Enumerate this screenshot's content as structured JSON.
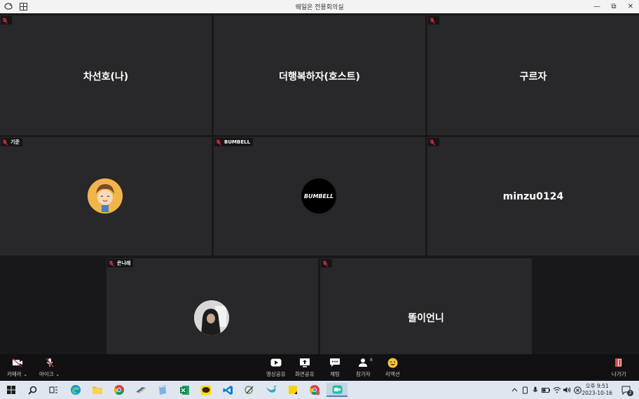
{
  "window": {
    "title": "웨일온 전용회의실",
    "minimize": "—",
    "restore": "⧉",
    "close": "✕"
  },
  "participants": [
    {
      "id": "p1",
      "center_name": "차선호(나)",
      "tag_name": ""
    },
    {
      "id": "p2",
      "center_name": "더행복하자(호스트)",
      "tag_name": ""
    },
    {
      "id": "p3",
      "center_name": "구르자",
      "tag_name": ""
    },
    {
      "id": "p4",
      "center_name": "",
      "tag_name": "기준"
    },
    {
      "id": "p5",
      "center_name": "",
      "tag_name": "BUMBELL",
      "avatar_text": "BUMBELL"
    },
    {
      "id": "p6",
      "center_name": "minzu0124",
      "tag_name": ""
    },
    {
      "id": "p7",
      "center_name": "",
      "tag_name": "은나래"
    },
    {
      "id": "p8",
      "center_name": "똘이언니",
      "tag_name": ""
    }
  ],
  "toolbar": {
    "camera": "카메라",
    "mic": "마이크",
    "video_share": "영상공유",
    "screen_share": "화면공유",
    "chat": "채팅",
    "participants": "참가자",
    "participants_count": "8",
    "reaction": "리액션",
    "leave": "나가기"
  },
  "taskbar": {
    "time": "오후 9:51",
    "date": "2023-10-16",
    "notifications": "2"
  },
  "colors": {
    "mic_muted": "#c0303a",
    "accent": "#4a7cc7"
  }
}
